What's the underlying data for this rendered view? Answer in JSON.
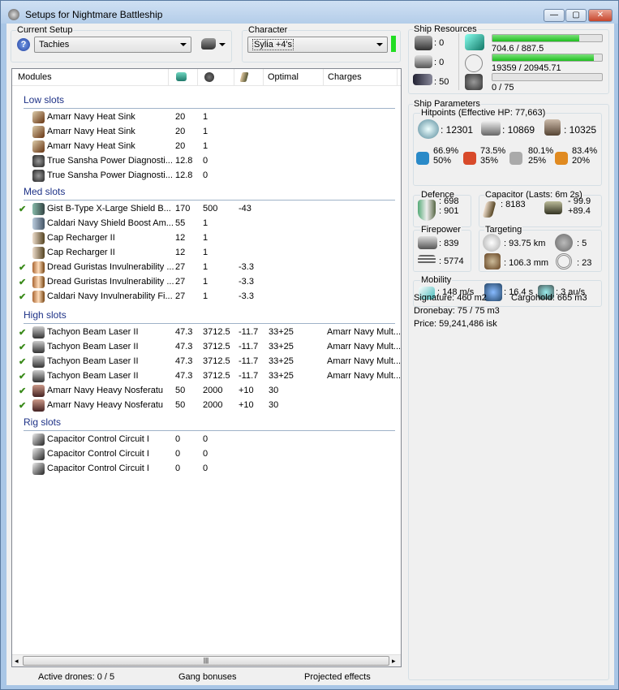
{
  "window": {
    "title": "Setups for Nightmare Battleship",
    "controls": [
      "minimize",
      "maximize",
      "close"
    ]
  },
  "setup": {
    "label": "Current Setup",
    "value": "Tachies",
    "help_icon": "question-icon",
    "ship_icon": "ship-icon"
  },
  "character": {
    "label": "Character",
    "value": "Sylia +4's",
    "status_color": "#22dd22"
  },
  "columns": {
    "modules": "Modules",
    "cpu_icon": "cpu-icon",
    "pg_icon": "powergrid-icon",
    "cap_icon": "capacitor-icon",
    "optimal": "Optimal",
    "charges": "Charges"
  },
  "sections": [
    {
      "title": "Low slots",
      "rows": [
        {
          "check": false,
          "icon": "heat-sink-icon",
          "name": "Amarr Navy Heat Sink",
          "cpu": "20",
          "pg": "1",
          "cap": "",
          "optimal": "",
          "charges": ""
        },
        {
          "check": false,
          "icon": "heat-sink-icon",
          "name": "Amarr Navy Heat Sink",
          "cpu": "20",
          "pg": "1",
          "cap": "",
          "optimal": "",
          "charges": ""
        },
        {
          "check": false,
          "icon": "heat-sink-icon",
          "name": "Amarr Navy Heat Sink",
          "cpu": "20",
          "pg": "1",
          "cap": "",
          "optimal": "",
          "charges": ""
        },
        {
          "check": false,
          "icon": "power-diagnostic-icon",
          "name": "True Sansha Power Diagnosti...",
          "cpu": "12.8",
          "pg": "0",
          "cap": "",
          "optimal": "",
          "charges": ""
        },
        {
          "check": false,
          "icon": "power-diagnostic-icon",
          "name": "True Sansha Power Diagnosti...",
          "cpu": "12.8",
          "pg": "0",
          "cap": "",
          "optimal": "",
          "charges": ""
        }
      ]
    },
    {
      "title": "Med slots",
      "rows": [
        {
          "check": true,
          "icon": "shield-booster-icon",
          "name": "Gist B-Type X-Large Shield B...",
          "cpu": "170",
          "pg": "500",
          "cap": "-43",
          "optimal": "",
          "charges": ""
        },
        {
          "check": false,
          "icon": "shield-boost-amplifier-icon",
          "name": "Caldari Navy Shield Boost Am...",
          "cpu": "55",
          "pg": "1",
          "cap": "",
          "optimal": "",
          "charges": ""
        },
        {
          "check": false,
          "icon": "cap-recharger-icon",
          "name": "Cap Recharger II",
          "cpu": "12",
          "pg": "1",
          "cap": "",
          "optimal": "",
          "charges": ""
        },
        {
          "check": false,
          "icon": "cap-recharger-icon",
          "name": "Cap Recharger II",
          "cpu": "12",
          "pg": "1",
          "cap": "",
          "optimal": "",
          "charges": ""
        },
        {
          "check": true,
          "icon": "invulnerability-field-icon",
          "name": "Dread Guristas Invulnerability ...",
          "cpu": "27",
          "pg": "1",
          "cap": "-3.3",
          "optimal": "",
          "charges": ""
        },
        {
          "check": true,
          "icon": "invulnerability-field-icon",
          "name": "Dread Guristas Invulnerability ...",
          "cpu": "27",
          "pg": "1",
          "cap": "-3.3",
          "optimal": "",
          "charges": ""
        },
        {
          "check": true,
          "icon": "invulnerability-field-icon",
          "name": "Caldari Navy Invulnerability Fi...",
          "cpu": "27",
          "pg": "1",
          "cap": "-3.3",
          "optimal": "",
          "charges": ""
        }
      ]
    },
    {
      "title": "High slots",
      "rows": [
        {
          "check": true,
          "icon": "beam-laser-icon",
          "name": "Tachyon Beam Laser II",
          "cpu": "47.3",
          "pg": "3712.5",
          "cap": "-11.7",
          "optimal": "33+25",
          "charges": "Amarr Navy Mult..."
        },
        {
          "check": true,
          "icon": "beam-laser-icon",
          "name": "Tachyon Beam Laser II",
          "cpu": "47.3",
          "pg": "3712.5",
          "cap": "-11.7",
          "optimal": "33+25",
          "charges": "Amarr Navy Mult..."
        },
        {
          "check": true,
          "icon": "beam-laser-icon",
          "name": "Tachyon Beam Laser II",
          "cpu": "47.3",
          "pg": "3712.5",
          "cap": "-11.7",
          "optimal": "33+25",
          "charges": "Amarr Navy Mult..."
        },
        {
          "check": true,
          "icon": "beam-laser-icon",
          "name": "Tachyon Beam Laser II",
          "cpu": "47.3",
          "pg": "3712.5",
          "cap": "-11.7",
          "optimal": "33+25",
          "charges": "Amarr Navy Mult..."
        },
        {
          "check": true,
          "icon": "nosferatu-icon",
          "name": "Amarr Navy Heavy Nosferatu",
          "cpu": "50",
          "pg": "2000",
          "cap": "+10",
          "optimal": "30",
          "charges": ""
        },
        {
          "check": true,
          "icon": "nosferatu-icon",
          "name": "Amarr Navy Heavy Nosferatu",
          "cpu": "50",
          "pg": "2000",
          "cap": "+10",
          "optimal": "30",
          "charges": ""
        }
      ]
    },
    {
      "title": "Rig slots",
      "rows": [
        {
          "check": false,
          "icon": "rig-icon",
          "name": "Capacitor Control Circuit I",
          "cpu": "0",
          "pg": "0",
          "cap": "",
          "optimal": "",
          "charges": ""
        },
        {
          "check": false,
          "icon": "rig-icon",
          "name": "Capacitor Control Circuit I",
          "cpu": "0",
          "pg": "0",
          "cap": "",
          "optimal": "",
          "charges": ""
        },
        {
          "check": false,
          "icon": "rig-icon",
          "name": "Capacitor Control Circuit I",
          "cpu": "0",
          "pg": "0",
          "cap": "",
          "optimal": "",
          "charges": ""
        }
      ]
    }
  ],
  "status": {
    "drones": "Active drones: 0 / 5",
    "gang": "Gang bonuses",
    "projected": "Projected effects"
  },
  "resources": {
    "title": "Ship Resources",
    "turrets": ": 0",
    "launchers": ": 0",
    "calibration": ": 50",
    "cpu": {
      "text": "704.6 / 887.5",
      "fraction": 0.794
    },
    "powergrid": {
      "text": "19359 / 20945.71",
      "fraction": 0.924
    },
    "drone_bandwidth": {
      "text": "0 / 75",
      "fraction": 0
    }
  },
  "parameters": {
    "title": "Ship Parameters",
    "hitpoints": {
      "title": "Hitpoints (Effective HP: 77,663)",
      "shield": ": 12301",
      "armor": ": 10869",
      "structure": ": 10325",
      "resists": [
        {
          "icon": "em-icon",
          "a": "66.9%",
          "b": "50%",
          "color": "#2a8ac8"
        },
        {
          "icon": "thermal-icon",
          "a": "73.5%",
          "b": "35%",
          "color": "#d84a2a"
        },
        {
          "icon": "kinetic-icon",
          "a": "80.1%",
          "b": "25%",
          "color": "#aaaaaa"
        },
        {
          "icon": "explosive-icon",
          "a": "83.4%",
          "b": "20%",
          "color": "#e08a20"
        }
      ]
    },
    "defence": {
      "title": "Defence",
      "a": ": 698",
      "b": ": 901"
    },
    "capacitor": {
      "title": "Capacitor (Lasts: 6m 2s)",
      "amount": ": 8183",
      "a": "- 99.9",
      "b": "+89.4"
    },
    "firepower": {
      "title": "Firepower",
      "dps": ": 839",
      "volley": ": 5774"
    },
    "targeting": {
      "title": "Targeting",
      "range": ": 93.75 km",
      "targets": ": 5",
      "resolution": ": 106.3 mm",
      "sensor": ": 23"
    },
    "mobility": {
      "title": "Mobility",
      "speed": ": 148 m/s",
      "align": ": 16.4 s",
      "warp": ": 3 au/s"
    },
    "signature": "Signature: 460 m2",
    "cargohold": "Cargohold: 665 m3",
    "dronebay": "Dronebay: 75 / 75 m3",
    "price": "Price: 59,241,486 isk"
  }
}
